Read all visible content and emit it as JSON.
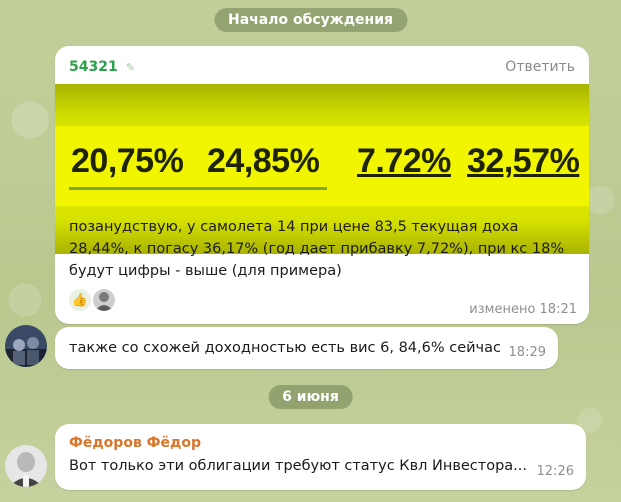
{
  "top_pill": "Начало обсуждения",
  "message1": {
    "sender": "54321",
    "reply_label": "Ответить",
    "image_values": [
      "20,75%",
      "24,85%",
      "7.72%",
      "32,57%"
    ],
    "text": "позанудствую, у самолета 14 при цене 83,5 текущая доха 28,44%, к погасу 36,17% (год дает прибавку 7,72%), при кс 18% будут цифры - выше (для примера)",
    "reaction_icons": [
      "thumbs-up-icon",
      "person-avatar-icon"
    ],
    "time": "изменено 18:21"
  },
  "message2": {
    "text": "также со схожей доходностью есть вис 6, 84,6% сейчас",
    "time": "18:29"
  },
  "date_pill": "6 июня",
  "message3": {
    "sender": "Фёдоров Фёдор",
    "text": "Вот только эти облигации требуют статус Квл Инвестора...",
    "time": "12:26"
  },
  "colors": {
    "sender_green": "#2aa14a",
    "sender_orange": "#d8752a",
    "pill_bg": "rgba(110,130,80,0.55)"
  }
}
